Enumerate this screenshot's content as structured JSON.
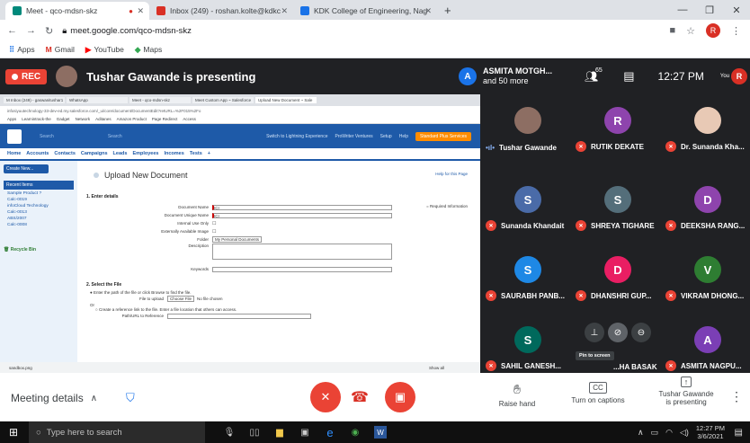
{
  "browser": {
    "tabs": [
      {
        "label": "Meet - qco-mdsn-skz",
        "color": "#00897b",
        "active": true
      },
      {
        "label": "Inbox (249) - roshan.kolte@kdkc",
        "color": "#d93025"
      },
      {
        "label": "KDK College of Engineering, Nag",
        "color": "#1a73e8"
      }
    ],
    "new_tab": "+",
    "url": "meet.google.com/qco-mdsn-skz",
    "bookmarks": [
      "Apps",
      "Gmail",
      "YouTube",
      "Maps"
    ],
    "avatar": "R"
  },
  "meet_top": {
    "rec_label": "REC",
    "presenting_title": "Tushar Gawande is presenting",
    "viewer_avatar": "A",
    "viewer_line1": "ASMITA MOTGH...",
    "viewer_line2": "and 50 more",
    "people_count": "65",
    "time": "12:27 PM",
    "you_label": "You",
    "you_avatar": "R"
  },
  "shared": {
    "tabs": [
      "M Inbox (249) - gaswanitushar1",
      "WhatsApp",
      "Meet - qco-mdsn-skz",
      "Meet Custom App ~ Salesforce",
      "Upload New Document ~ Sale"
    ],
    "address": "infosiyuutechnology-33-dev-ed.my.salesforce.com/_ui/core/document/DocumentEdit?retURL=%2F015%2Fo",
    "bookmarks": [
      "Apps",
      "Learnintrack-the",
      "Gadget",
      "Network",
      "Aditanes",
      "Amazon Product",
      "Page Redirect",
      "Access"
    ],
    "nav": [
      "Home",
      "Accounts",
      "Contacts",
      "Campaigns",
      "Leads",
      "Employees",
      "Incomes",
      "Tests",
      "+"
    ],
    "search_label": "Search",
    "search_btn": "Search",
    "header_links": [
      "Switch to Lightning Experience",
      "ProWriter Ventures",
      "Setup",
      "Help"
    ],
    "org_badge": "Standard Plus Services",
    "create_new": "Create New...",
    "recent_title": "Recent Items",
    "recent_items": [
      "Sample Product ?",
      "Calc-0019",
      "infoCloud Technology",
      "Calc-0013",
      "ABS/2007",
      "Calc-0008"
    ],
    "recycle": "Recycle Bin",
    "page_heading": "Upload New Document",
    "help_link": "Help for this Page",
    "section1": "1. Enter details",
    "required_note": "= Required Information",
    "fields": [
      "Document Name",
      "Document Unique Name",
      "Internal Use Only",
      "Externally Available Image",
      "Folder",
      "Description",
      "Keywords"
    ],
    "field_values": [
      "ICI",
      "ICI",
      "",
      "",
      "My Personal Documents",
      "",
      ""
    ],
    "section2": "2. Select the File",
    "file_hint1": "Enter the path of the file or click Browse to find the file.",
    "file_label": "File to upload",
    "choose_file": "Choose File",
    "no_file": "No file chosen",
    "or": "Or",
    "file_hint2": "Create a reference link to the file. Enter a file location that others can access.",
    "file_location": "Path/URL to Reference",
    "status_left": "sandbox.png",
    "status_right": "Show all"
  },
  "participants": [
    {
      "name": "Tushar Gawande",
      "avatar": "",
      "color": "#8d6e63",
      "speaking": true,
      "muted": false
    },
    {
      "name": "RUTIK DEKATE",
      "avatar": "R",
      "color": "#8e44ad",
      "muted": true
    },
    {
      "name": "Dr. Sunanda Kha...",
      "avatar": "",
      "color": "#e8c9b5",
      "muted": true
    },
    {
      "name": "Sunanda Khandait",
      "avatar": "S",
      "color": "#4a6ba8",
      "muted": true
    },
    {
      "name": "SHREYA TIGHARE",
      "avatar": "S",
      "color": "#546e7a",
      "muted": true
    },
    {
      "name": "DEEKSHA RANG...",
      "avatar": "D",
      "color": "#8e44ad",
      "muted": true
    },
    {
      "name": "SAURABH PANB...",
      "avatar": "S",
      "color": "#1e88e5",
      "muted": true
    },
    {
      "name": "DHANSHRI GUP...",
      "avatar": "D",
      "color": "#e91e63",
      "muted": true
    },
    {
      "name": "VIKRAM DHONG...",
      "avatar": "V",
      "color": "#2e7d32",
      "muted": true
    },
    {
      "name": "SAHIL GANESH...",
      "avatar": "S",
      "color": "#00695c",
      "muted": true
    },
    {
      "name": "...HA BASAK",
      "avatar": "",
      "color": "#202124",
      "muted": false
    },
    {
      "name": "ASMITA NAGPU...",
      "avatar": "A",
      "color": "#7b3fb5",
      "muted": true
    }
  ],
  "tile_controls": {
    "tooltip": "Pin to screen"
  },
  "bottom_bar": {
    "meeting_details": "Meeting details",
    "raise_hand": "Raise hand",
    "captions": "Turn on captions",
    "presenting_line1": "Tushar Gawande",
    "presenting_line2": "is presenting"
  },
  "taskbar": {
    "search_placeholder": "Type here to search",
    "time": "12:27 PM",
    "date": "3/6/2021"
  },
  "colors": {
    "danger": "#ea4335",
    "meet_bg": "#202124",
    "sf_blue": "#1e5aa8"
  }
}
